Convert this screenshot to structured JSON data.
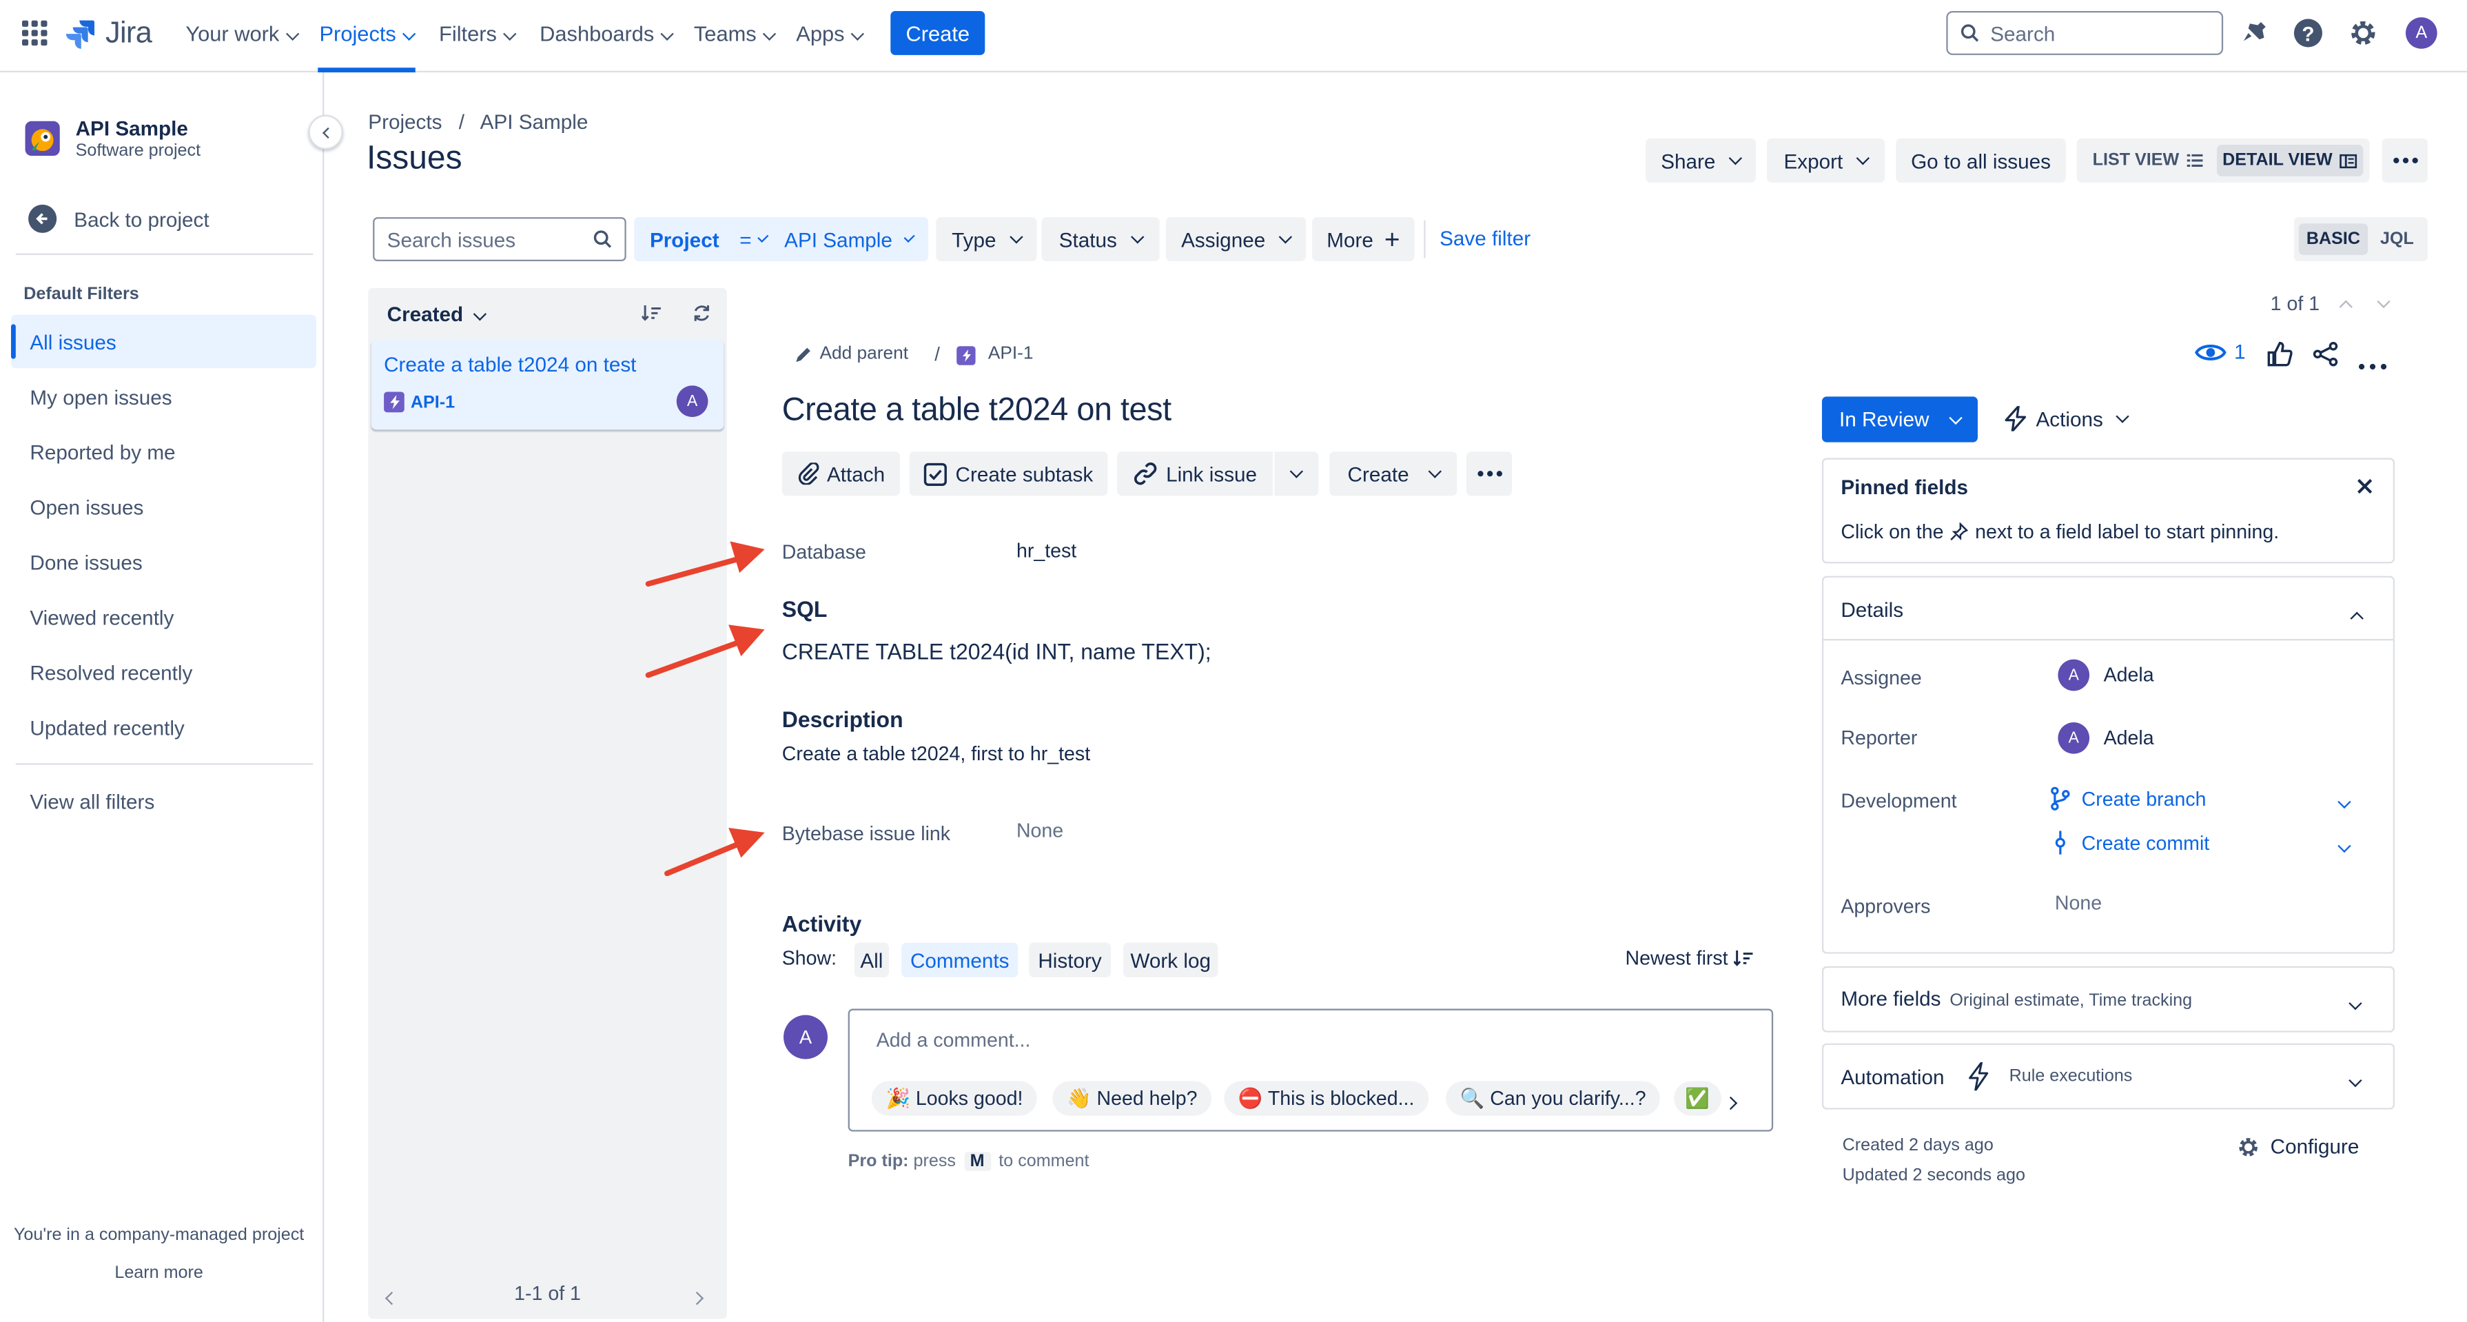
{
  "topnav": {
    "logo": "Jira",
    "items": [
      {
        "label": "Your work"
      },
      {
        "label": "Projects"
      },
      {
        "label": "Filters"
      },
      {
        "label": "Dashboards"
      },
      {
        "label": "Teams"
      },
      {
        "label": "Apps"
      }
    ],
    "create_label": "Create",
    "search_placeholder": "Search",
    "avatar": "A"
  },
  "sidebar": {
    "project_name": "API Sample",
    "project_type": "Software project",
    "back_label": "Back to project",
    "section_label": "Default Filters",
    "items": [
      {
        "label": "All issues"
      },
      {
        "label": "My open issues"
      },
      {
        "label": "Reported by me"
      },
      {
        "label": "Open issues"
      },
      {
        "label": "Done issues"
      },
      {
        "label": "Viewed recently"
      },
      {
        "label": "Resolved recently"
      },
      {
        "label": "Updated recently"
      }
    ],
    "view_all": "View all filters",
    "footer_text": "You're in a company-managed project",
    "learn_more": "Learn more"
  },
  "header": {
    "breadcrumb": [
      "Projects",
      "API Sample"
    ],
    "breadcrumb_sep": "/",
    "title": "Issues",
    "share": "Share",
    "export": "Export",
    "go_all": "Go to all issues",
    "list_view": "LIST VIEW",
    "detail_view": "DETAIL VIEW"
  },
  "filters": {
    "search_placeholder": "Search issues",
    "project_label": "Project",
    "project_op": "=",
    "project_value": "API Sample",
    "type": "Type",
    "status": "Status",
    "assignee": "Assignee",
    "more": "More",
    "save_filter": "Save filter",
    "basic": "BASIC",
    "jql": "JQL"
  },
  "list": {
    "sort_label": "Created",
    "items": [
      {
        "title": "Create a table t2024 on test",
        "key": "API-1",
        "avatar": "A"
      }
    ],
    "pagination": "1-1 of 1"
  },
  "issue": {
    "counter": "1 of 1",
    "add_parent": "Add parent",
    "breadcrumb_sep": "/",
    "key": "API-1",
    "watchers": "1",
    "title": "Create a table t2024 on test",
    "attach": "Attach",
    "create_subtask": "Create subtask",
    "link_issue": "Link issue",
    "create": "Create",
    "database_label": "Database",
    "database_value": "hr_test",
    "sql_heading": "SQL",
    "sql_value": "CREATE TABLE t2024(id INT, name TEXT);",
    "description_heading": "Description",
    "description_value": "Create a table t2024, first to hr_test",
    "bytebase_label": "Bytebase issue link",
    "bytebase_value": "None",
    "activity_heading": "Activity",
    "show_label": "Show:",
    "activity_tabs": [
      "All",
      "Comments",
      "History",
      "Work log"
    ],
    "sort_order": "Newest first",
    "comment_avatar": "A",
    "comment_placeholder": "Add a comment...",
    "quick_replies": [
      "🎉 Looks good!",
      "👋 Need help?",
      "⛔ This is blocked...",
      "🔍 Can you clarify...?",
      "✅"
    ],
    "pro_tip_prefix": "Pro tip:",
    "pro_tip_press": "press",
    "pro_tip_key": "M",
    "pro_tip_suffix": "to comment"
  },
  "details_panel": {
    "status": "In Review",
    "actions": "Actions",
    "pinned_title": "Pinned fields",
    "pinned_text_a": "Click on the",
    "pinned_text_b": "next to a field label to start pinning.",
    "details_title": "Details",
    "assignee_label": "Assignee",
    "assignee_value": "Adela",
    "reporter_label": "Reporter",
    "reporter_value": "Adela",
    "development_label": "Development",
    "create_branch": "Create branch",
    "create_commit": "Create commit",
    "approvers_label": "Approvers",
    "approvers_value": "None",
    "more_fields": "More fields",
    "more_fields_sub": "Original estimate, Time tracking",
    "automation": "Automation",
    "rule_executions": "Rule executions",
    "created": "Created 2 days ago",
    "updated": "Updated 2 seconds ago",
    "configure": "Configure"
  },
  "colors": {
    "accent": "#0c66e4",
    "annotation_arrow": "#e8432e",
    "avatar": "#5e4db2"
  }
}
